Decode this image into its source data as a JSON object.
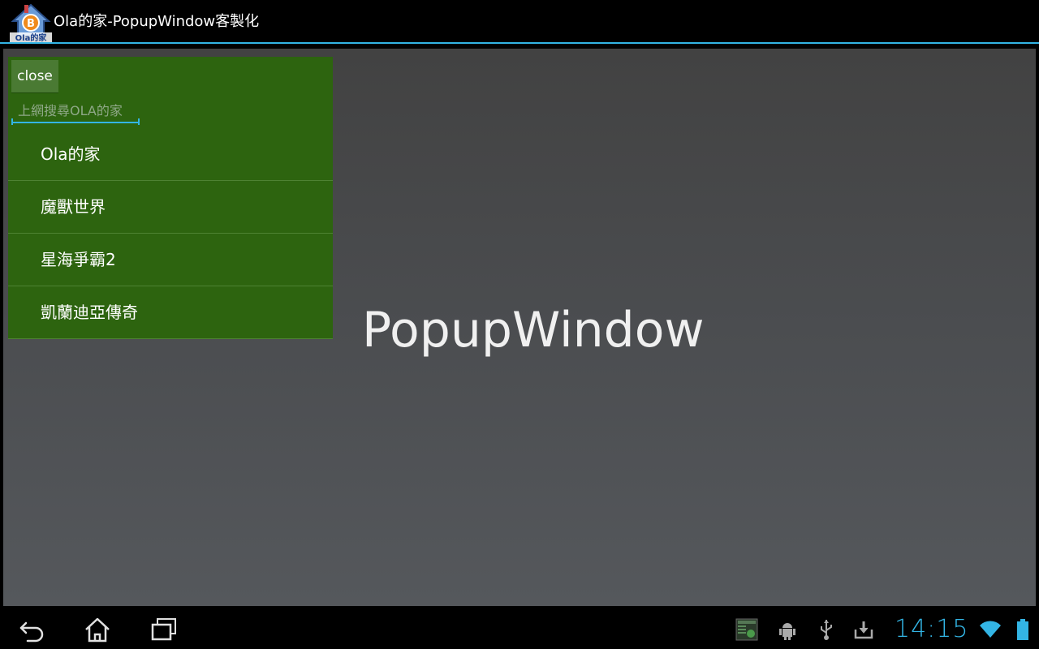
{
  "app": {
    "title": "Ola的家-PopupWindow客製化",
    "logo_text": "Ola的家"
  },
  "main": {
    "center_text": "PopupWindow"
  },
  "popup": {
    "close_label": "close",
    "search_placeholder": "上網搜尋OLA的家",
    "items": [
      {
        "label": "Ola的家"
      },
      {
        "label": "魔獸世界"
      },
      {
        "label": "星海爭霸2"
      },
      {
        "label": "凱蘭迪亞傳奇"
      }
    ]
  },
  "status_bar": {
    "time": "14:15"
  },
  "colors": {
    "accent": "#33b5e5",
    "popup_bg": "#2d640f",
    "button_bg": "#4a7a33"
  }
}
